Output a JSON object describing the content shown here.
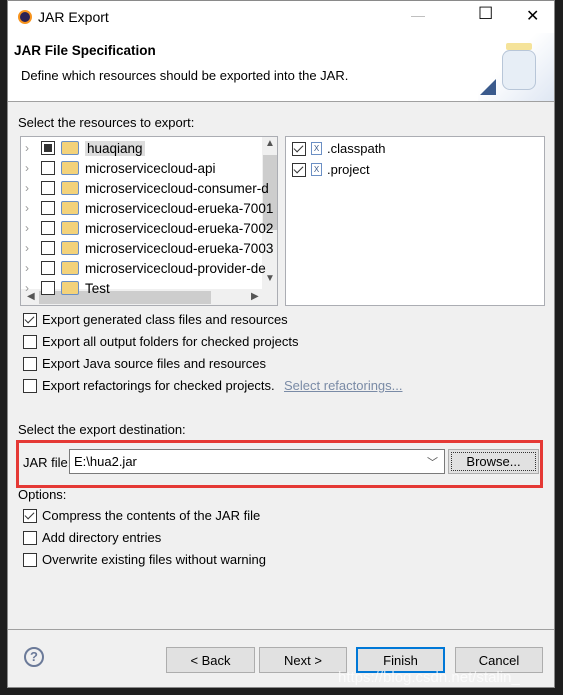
{
  "window": {
    "title": "JAR Export",
    "minimize": "—",
    "maximize": "☐",
    "close": "✕"
  },
  "header": {
    "title": "JAR File Specification",
    "description": "Define which resources should be exported into the JAR."
  },
  "resources": {
    "label": "Select the resources to export:",
    "tree": [
      {
        "label": "huaqiang",
        "state": "partial"
      },
      {
        "label": "microservicecloud-api",
        "state": "off"
      },
      {
        "label": "microservicecloud-consumer-d",
        "state": "off"
      },
      {
        "label": "microservicecloud-erueka-7001",
        "state": "off"
      },
      {
        "label": "microservicecloud-erueka-7002",
        "state": "off"
      },
      {
        "label": "microservicecloud-erueka-7003",
        "state": "off"
      },
      {
        "label": "microservicecloud-provider-de",
        "state": "off"
      },
      {
        "label": "Test",
        "state": "off"
      }
    ],
    "files": [
      {
        "label": ".classpath",
        "checked": true
      },
      {
        "label": ".project",
        "checked": true
      }
    ]
  },
  "export_options": [
    {
      "label": "Export generated class files and resources",
      "checked": true
    },
    {
      "label": "Export all output folders for checked projects",
      "checked": false
    },
    {
      "label": "Export Java source files and resources",
      "checked": false
    },
    {
      "label": "Export refactorings for checked projects.",
      "checked": false
    }
  ],
  "select_refactorings_link": "Select refactorings...",
  "destination": {
    "label": "Select the export destination:",
    "jar_label": "JAR file:",
    "jar_value": "E:\\hua2.jar",
    "browse": "Browse..."
  },
  "options": {
    "label": "Options:",
    "items": [
      {
        "label": "Compress the contents of the JAR file",
        "checked": true
      },
      {
        "label": "Add directory entries",
        "checked": false
      },
      {
        "label": "Overwrite existing files without warning",
        "checked": false
      }
    ]
  },
  "buttons": {
    "help": "?",
    "back": "< Back",
    "next": "Next >",
    "finish": "Finish",
    "cancel": "Cancel"
  },
  "watermark": "https://blog.csdn.net/stalin_",
  "colors": {
    "highlight": "#e53935",
    "link": "#7a8ba6",
    "focus": "#0078d7"
  }
}
